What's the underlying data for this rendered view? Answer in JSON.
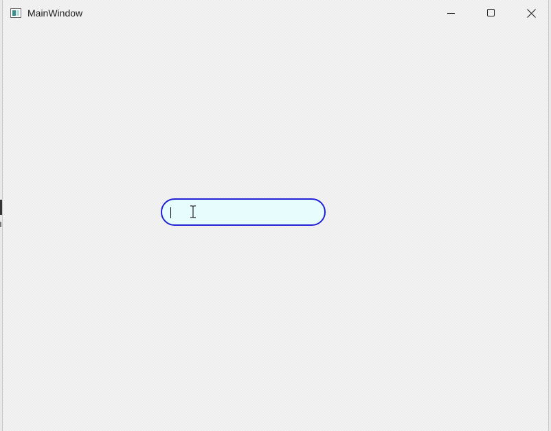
{
  "window": {
    "title": "MainWindow"
  },
  "titlebar": {
    "app_icon": "app-window-icon",
    "minimize_icon": "minimize-icon",
    "maximize_icon": "maximize-icon",
    "close_icon": "close-icon"
  },
  "textbox": {
    "value": "",
    "focused": true,
    "border_color": "#1f1fd6",
    "background_color": "#e6fcfd"
  },
  "cursor": {
    "icon": "ibeam-cursor-icon"
  }
}
